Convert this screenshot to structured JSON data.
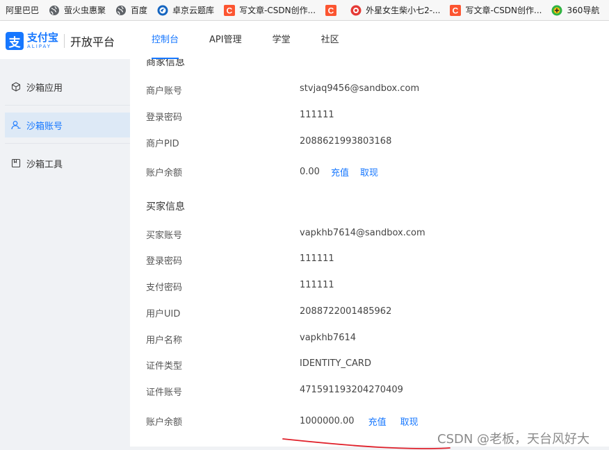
{
  "bookmarks": [
    {
      "label": "阿里巴巴",
      "icon": "none"
    },
    {
      "label": "萤火虫惠聚",
      "icon": "globe-icon"
    },
    {
      "label": "百度",
      "icon": "globe-icon"
    },
    {
      "label": "卓京云题库",
      "icon": "chrome-like-icon"
    },
    {
      "label": "写文章-CSDN创作...",
      "icon": "csdn-icon"
    },
    {
      "label": "",
      "icon": "csdn-icon"
    },
    {
      "label": "外星女生柴小七2-...",
      "icon": "play-icon"
    },
    {
      "label": "写文章-CSDN创作...",
      "icon": "csdn-icon"
    },
    {
      "label": "360导航",
      "icon": "360-icon"
    }
  ],
  "brand": {
    "logo_mark": "支",
    "logo_cn": "支付宝",
    "logo_en": "ALIPAY",
    "platform": "开放平台",
    "color": "#1677ff"
  },
  "nav": {
    "tabs": [
      {
        "label": "控制台",
        "active": true
      },
      {
        "label": "API管理",
        "active": false
      },
      {
        "label": "学堂",
        "active": false
      },
      {
        "label": "社区",
        "active": false
      }
    ]
  },
  "sidebar": {
    "items": [
      {
        "label": "沙箱应用",
        "icon": "cube-icon",
        "active": false
      },
      {
        "label": "沙箱账号",
        "icon": "user-icon",
        "active": true
      },
      {
        "label": "沙箱工具",
        "icon": "tool-icon",
        "active": false
      }
    ]
  },
  "merchant": {
    "title": "商家信息",
    "rows": [
      {
        "label": "商户账号",
        "value": "stvjaq9456@sandbox.com"
      },
      {
        "label": "登录密码",
        "value": "111111"
      },
      {
        "label": "商户PID",
        "value": "2088621993803168"
      },
      {
        "label": "账户余额",
        "value": "0.00",
        "links": [
          "充值",
          "取现"
        ]
      }
    ]
  },
  "buyer": {
    "title": "买家信息",
    "rows": [
      {
        "label": "买家账号",
        "value": "vapkhb7614@sandbox.com"
      },
      {
        "label": "登录密码",
        "value": "111111"
      },
      {
        "label": "支付密码",
        "value": "111111"
      },
      {
        "label": "用户UID",
        "value": "2088722001485962"
      },
      {
        "label": "用户名称",
        "value": "vapkhb7614"
      },
      {
        "label": "证件类型",
        "value": "IDENTITY_CARD"
      },
      {
        "label": "证件账号",
        "value": "471591193204270409"
      },
      {
        "label": "账户余额",
        "value": "1000000.00",
        "links": [
          "充值",
          "取现"
        ]
      }
    ]
  },
  "watermark": "CSDN @老板，天台风好大",
  "annotation_color": "#e0202a"
}
